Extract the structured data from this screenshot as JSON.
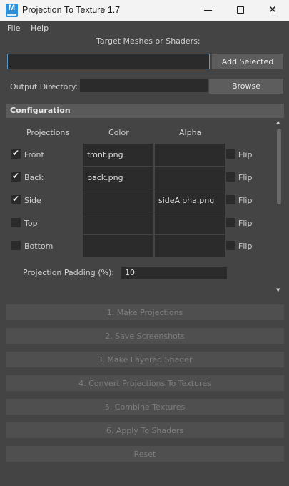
{
  "window": {
    "title": "Projection To Texture 1.7",
    "icon_letter": "M",
    "min_icon": "minimize-icon",
    "max_icon": "maximize-icon",
    "close_icon": "close-icon"
  },
  "menu": {
    "items": [
      "File",
      "Help"
    ]
  },
  "target": {
    "label": "Target Meshes or Shaders:",
    "value": "",
    "add_selected": "Add Selected"
  },
  "output": {
    "label": "Output Directory:",
    "value": "",
    "browse": "Browse"
  },
  "config": {
    "header": "Configuration",
    "columns": {
      "projections": "Projections",
      "color": "Color",
      "alpha": "Alpha"
    },
    "rows": [
      {
        "name": "Front",
        "checked": true,
        "color": "front.png",
        "alpha": "",
        "flip_label": "Flip",
        "flip": false
      },
      {
        "name": "Back",
        "checked": true,
        "color": "back.png",
        "alpha": "",
        "flip_label": "Flip",
        "flip": false
      },
      {
        "name": "Side",
        "checked": true,
        "color": "",
        "alpha": "sideAlpha.png",
        "flip_label": "Flip",
        "flip": false
      },
      {
        "name": "Top",
        "checked": false,
        "color": "",
        "alpha": "",
        "flip_label": "Flip",
        "flip": false
      },
      {
        "name": "Bottom",
        "checked": false,
        "color": "",
        "alpha": "",
        "flip_label": "Flip",
        "flip": false
      }
    ],
    "padding_label": "Projection Padding (%):",
    "padding_value": "10"
  },
  "steps": {
    "make_projections": "1. Make Projections",
    "save_screenshots": "2. Save Screenshots",
    "make_layered": "3. Make Layered Shader",
    "convert": "4. Convert Projections To Textures",
    "combine": "5. Combine Textures",
    "apply": "6. Apply To Shaders",
    "reset": "Reset"
  },
  "colors": {
    "window_bg": "#444444",
    "field_bg": "#2b2b2b",
    "button_bg": "#5d5d5d",
    "disabled_button_bg": "#4f4f4f",
    "frame_header_bg": "#5a5a5a",
    "focus_border": "#5f95bf",
    "titlebar_bg": "#f3f3f3"
  }
}
